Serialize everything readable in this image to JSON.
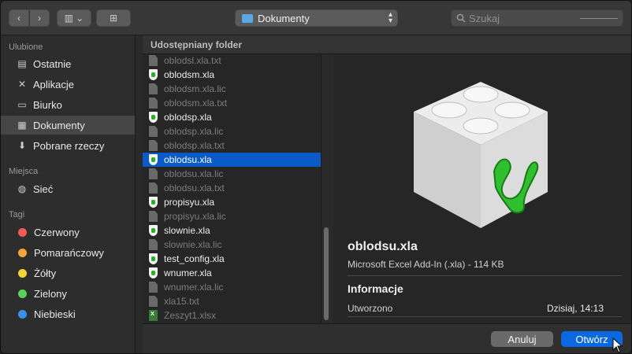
{
  "toolbar": {
    "back_glyph": "‹",
    "forward_glyph": "›",
    "view_glyph": "▥ ⌄",
    "new_folder_glyph": "⊞",
    "location": "Dokumenty",
    "search_placeholder": "Szukaj"
  },
  "sidebar": {
    "favorites_title": "Ulubione",
    "favorites": [
      {
        "label": "Ostatnie",
        "icon": "recents-icon"
      },
      {
        "label": "Aplikacje",
        "icon": "applications-icon"
      },
      {
        "label": "Biurko",
        "icon": "desktop-icon"
      },
      {
        "label": "Dokumenty",
        "icon": "documents-icon",
        "selected": true
      },
      {
        "label": "Pobrane rzeczy",
        "icon": "downloads-icon"
      }
    ],
    "places_title": "Miejsca",
    "places": [
      {
        "label": "Sieć",
        "icon": "network-icon"
      }
    ],
    "tags_title": "Tagi",
    "tags": [
      {
        "label": "Czerwony",
        "color": "#f25a54"
      },
      {
        "label": "Pomarańczowy",
        "color": "#f5a33a"
      },
      {
        "label": "Żółty",
        "color": "#f4d539"
      },
      {
        "label": "Zielony",
        "color": "#5bd05b"
      },
      {
        "label": "Niebieski",
        "color": "#3b8ff0"
      }
    ]
  },
  "column_header": "Udostępniany folder",
  "files": [
    {
      "name": "oblodsl.xla.txt",
      "type": "doc",
      "dim": true
    },
    {
      "name": "oblodsm.xla",
      "type": "xla",
      "dim": false
    },
    {
      "name": "oblodsm.xla.lic",
      "type": "doc",
      "dim": true
    },
    {
      "name": "oblodsm.xla.txt",
      "type": "doc",
      "dim": true
    },
    {
      "name": "oblodsp.xla",
      "type": "xla",
      "dim": false
    },
    {
      "name": "oblodsp.xla.lic",
      "type": "doc",
      "dim": true
    },
    {
      "name": "oblodsp.xla.txt",
      "type": "doc",
      "dim": true
    },
    {
      "name": "oblodsu.xla",
      "type": "xla",
      "dim": false,
      "selected": true
    },
    {
      "name": "oblodsu.xla.lic",
      "type": "doc",
      "dim": true
    },
    {
      "name": "oblodsu.xla.txt",
      "type": "doc",
      "dim": true
    },
    {
      "name": "propisyu.xla",
      "type": "xla",
      "dim": false
    },
    {
      "name": "propisyu.xla.lic",
      "type": "doc",
      "dim": true
    },
    {
      "name": "slownie.xla",
      "type": "xla",
      "dim": false
    },
    {
      "name": "slownie.xla.lic",
      "type": "doc",
      "dim": true
    },
    {
      "name": "test_config.xla",
      "type": "xla",
      "dim": false
    },
    {
      "name": "wnumer.xla",
      "type": "xla",
      "dim": false
    },
    {
      "name": "wnumer.xla.lic",
      "type": "doc",
      "dim": true
    },
    {
      "name": "xla15.txt",
      "type": "doc",
      "dim": true
    },
    {
      "name": "Zeszyt1.xlsx",
      "type": "xls",
      "dim": true
    }
  ],
  "preview": {
    "name": "oblodsu.xla",
    "kind": "Microsoft Excel Add-In (.xla) - 114 KB",
    "info_title": "Informacje",
    "created_label": "Utworzono",
    "created_value": "Dzisiaj, 14:13"
  },
  "buttons": {
    "cancel": "Anuluj",
    "open": "Otwórz"
  },
  "colors": {
    "selection": "#0a5ac7",
    "primary_button": "#0a68e0"
  }
}
